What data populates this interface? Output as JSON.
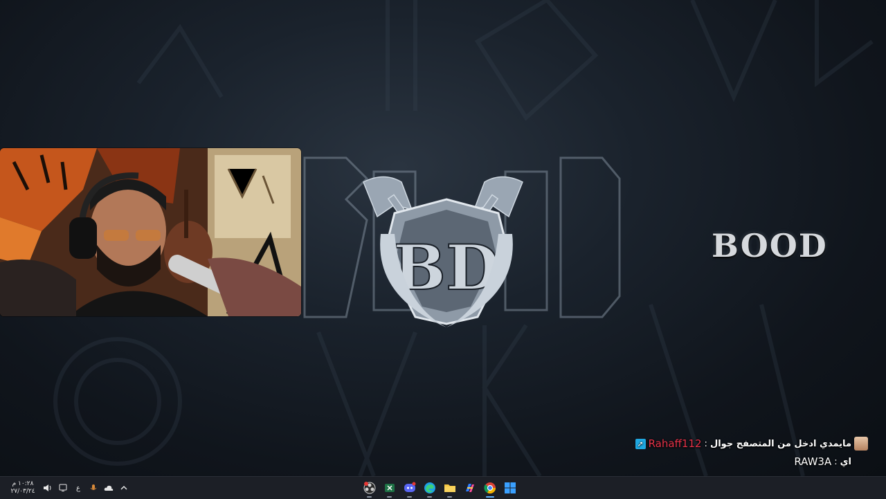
{
  "overlay": {
    "brand_text": "BOOD"
  },
  "chat": {
    "messages": [
      {
        "username": "Rahaff112",
        "username_color": "#e8334a",
        "text": "مايمدي ادخل من المتصفح جوال",
        "has_avatar": true,
        "badge_icon": "pin-icon"
      },
      {
        "username": "RAW3A",
        "username_color": "#ffffff",
        "text": "اي",
        "has_avatar": false,
        "badge_icon": ""
      }
    ],
    "separator": ":"
  },
  "taskbar": {
    "clock_time": "١٠:٢٨ م",
    "clock_date": "٢٧/٠٣/٢٤",
    "language": "ع",
    "tray_icons": [
      "volume-icon",
      "network-icon",
      "microphone-icon",
      "onedrive-icon",
      "show-hidden-icons-chevron"
    ],
    "apps": [
      {
        "name": "obs-studio-icon",
        "active": false
      },
      {
        "name": "excel-icon",
        "active": false
      },
      {
        "name": "discord-icon",
        "active": false
      },
      {
        "name": "edge-icon",
        "active": false
      },
      {
        "name": "file-explorer-icon",
        "active": false
      },
      {
        "name": "copilot-icon",
        "active": false
      },
      {
        "name": "chrome-icon",
        "active": true
      },
      {
        "name": "start-icon",
        "active": false
      }
    ]
  },
  "colors": {
    "accent": "#5fb2ff",
    "chat_username_red": "#e8334a",
    "taskbar_bg": "#1c1f26"
  }
}
